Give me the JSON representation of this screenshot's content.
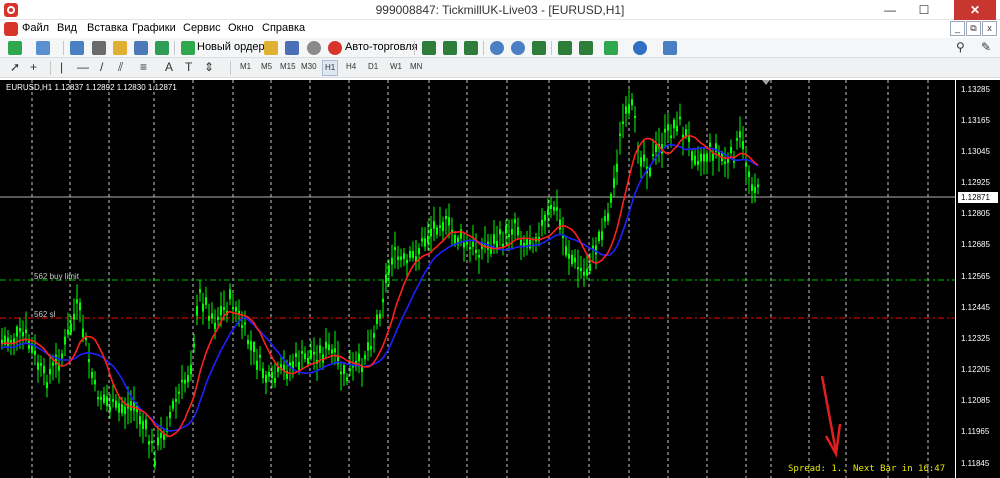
{
  "window": {
    "title": "999008847: TickmillUK-Live03 - [EURUSD,H1]",
    "minimize": "—",
    "maximize": "☐",
    "close": "✕"
  },
  "menu": {
    "items": [
      "Файл",
      "Вид",
      "Вставка",
      "Графики",
      "Сервис",
      "Окно",
      "Справка"
    ],
    "mdi_minimize": "_",
    "mdi_restore": "⧉",
    "mdi_close": "x"
  },
  "toolbar": {
    "new_order": "Новый ордер",
    "autotrading": "Авто-торговля"
  },
  "timeframes": [
    "M1",
    "M5",
    "M15",
    "M30",
    "H1",
    "H4",
    "D1",
    "W1",
    "MN"
  ],
  "active_timeframe": "H1",
  "chart": {
    "symbol_info": "EURUSD,H1  1.12837 1.12892 1.12830 1.12871",
    "current_price": "1.12871",
    "price_levels": [
      "1.13285",
      "1.13165",
      "1.13045",
      "1.12925",
      "1.12805",
      "1.12685",
      "1.12565",
      "1.12445",
      "1.12325",
      "1.12205",
      "1.12085",
      "1.11965",
      "1.11845"
    ],
    "buy_limit_label": "562 buy limit",
    "sl_label": "562 sl",
    "spread_text": "Spread: 1.. Next Bar in 16:47",
    "colors": {
      "background": "#000000",
      "candles": "#00ff00",
      "ma_fast": "#ff2020",
      "ma_slow": "#2020ff",
      "buy_limit_line": "#00c000",
      "sl_line": "#ff0000",
      "arrow": "#e02020",
      "spread_text": "#e8e800"
    }
  }
}
